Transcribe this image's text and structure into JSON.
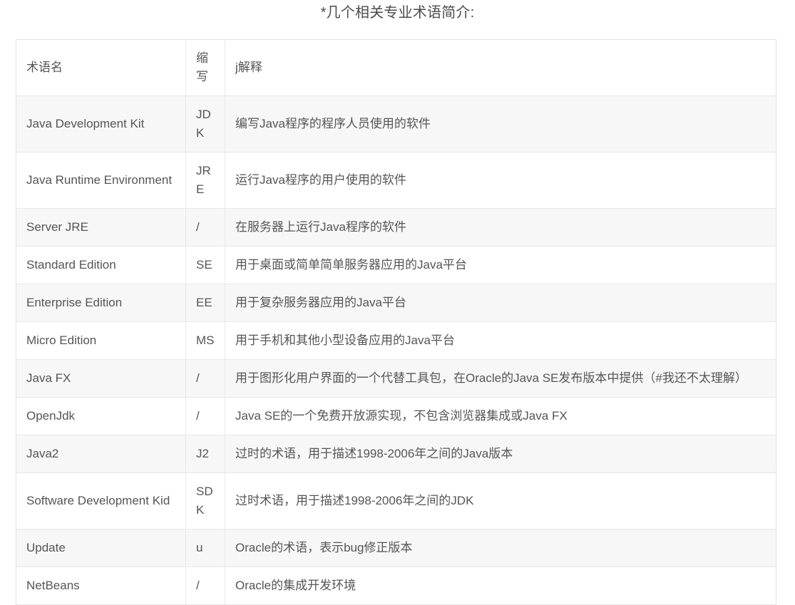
{
  "document": {
    "title": "*几个相关专业术语简介:"
  },
  "table": {
    "headers": {
      "term": "术语名",
      "abbr": "缩写",
      "desc": "j解释"
    },
    "rows": [
      {
        "term": "Java Development Kit",
        "abbr": "JDK",
        "desc": "编写Java程序的程序人员使用的软件"
      },
      {
        "term": "Java Runtime Environment",
        "abbr": "JRE",
        "desc": "运行Java程序的用户使用的软件"
      },
      {
        "term": "Server JRE",
        "abbr": "/",
        "desc": "在服务器上运行Java程序的软件"
      },
      {
        "term": "Standard Edition",
        "abbr": "SE",
        "desc": "用于桌面或简单简单服务器应用的Java平台"
      },
      {
        "term": "Enterprise Edition",
        "abbr": "EE",
        "desc": "用于复杂服务器应用的Java平台"
      },
      {
        "term": "Micro Edition",
        "abbr": "MS",
        "desc": "用于手机和其他小型设备应用的Java平台"
      },
      {
        "term": "Java FX",
        "abbr": "/",
        "desc": "用于图形化用户界面的一个代替工具包，在Oracle的Java SE发布版本中提供（#我还不太理解）"
      },
      {
        "term": "OpenJdk",
        "abbr": "/",
        "desc": "Java SE的一个免费开放源实现，不包含浏览器集成或Java FX"
      },
      {
        "term": "Java2",
        "abbr": "J2",
        "desc": "过时的术语，用于描述1998-2006年之间的Java版本"
      },
      {
        "term": "Software Development Kid",
        "abbr": "SDK",
        "desc": "过时术语，用于描述1998-2006年之间的JDK"
      },
      {
        "term": "Update",
        "abbr": "u",
        "desc": "Oracle的术语，表示bug修正版本"
      },
      {
        "term": "NetBeans",
        "abbr": "/",
        "desc": "Oracle的集成开发环境"
      }
    ]
  },
  "colors": {
    "text": "#555555",
    "title_text": "#4b4b4b",
    "border": "#e8e8e8",
    "stripe_background": "#f7f7f7",
    "page_background": "#ffffff"
  }
}
